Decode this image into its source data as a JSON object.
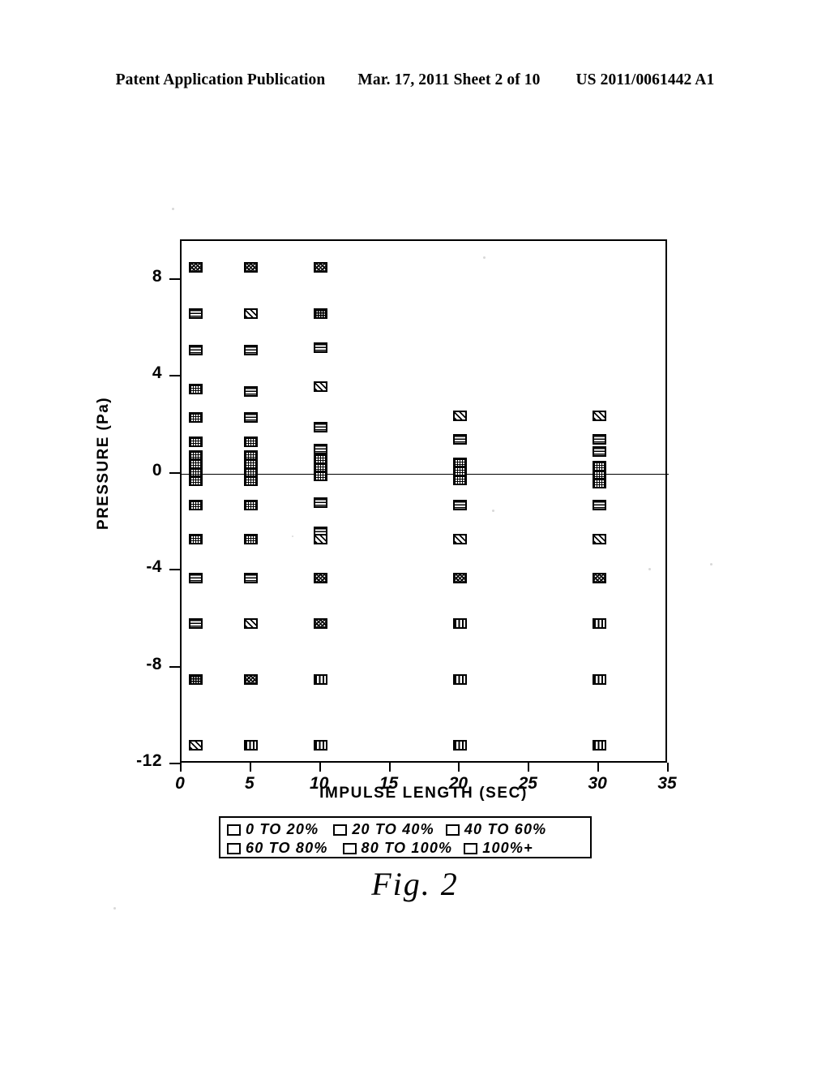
{
  "header": {
    "publication": "Patent Application Publication",
    "date_sheet": "Mar. 17, 2011  Sheet 2 of 10",
    "number": "US 2011/0061442 A1"
  },
  "figure": {
    "caption": "Fig.  2"
  },
  "chart_data": {
    "type": "scatter",
    "title": "",
    "xlabel": "IMPULSE LENGTH (SEC)",
    "ylabel": "PRESSURE (Pa)",
    "xlim": [
      0,
      35
    ],
    "ylim": [
      -12,
      9.6
    ],
    "xticks": [
      0,
      5,
      10,
      15,
      20,
      25,
      30,
      35
    ],
    "xtick_labels": [
      "0",
      "5",
      "10",
      "15",
      "20",
      "25",
      "30",
      "35"
    ],
    "yticks": [
      8,
      4,
      0,
      -4,
      -8,
      -12
    ],
    "ytick_labels": [
      "8",
      "4",
      "0",
      "-4",
      "-8",
      "-12"
    ],
    "grid": false,
    "zero_line": true,
    "legend_position": "below-axes",
    "categories": [
      "0 TO 20%",
      "20 TO 40%",
      "40 TO 60%",
      "60 TO 80%",
      "80 TO 100%",
      "100%+"
    ],
    "series": [
      {
        "name": "0 TO 20%",
        "pattern": "fine-cross-grid",
        "points": [
          [
            1,
            3.5
          ],
          [
            1,
            2.3
          ],
          [
            1,
            1.3
          ],
          [
            1,
            0.75
          ],
          [
            1,
            0.4
          ],
          [
            1,
            0.05
          ],
          [
            1,
            -0.3
          ],
          [
            1,
            -1.3
          ],
          [
            1,
            -2.7
          ],
          [
            5,
            1.3
          ],
          [
            5,
            0.75
          ],
          [
            5,
            0.4
          ],
          [
            5,
            0.05
          ],
          [
            5,
            -0.3
          ],
          [
            5,
            -1.3
          ],
          [
            5,
            -2.7
          ],
          [
            10,
            0.6
          ],
          [
            10,
            0.25
          ],
          [
            10,
            -0.1
          ],
          [
            20,
            0.45
          ],
          [
            20,
            0.1
          ],
          [
            20,
            -0.25
          ],
          [
            30,
            0.3
          ],
          [
            30,
            -0.05
          ],
          [
            30,
            -0.4
          ]
        ]
      },
      {
        "name": "20 TO 40%",
        "pattern": "horizontal-lines",
        "points": [
          [
            1,
            8.5
          ],
          [
            1,
            6.6
          ],
          [
            1,
            5.1
          ],
          [
            1,
            -4.3
          ],
          [
            1,
            -6.2
          ],
          [
            5,
            5.1
          ],
          [
            5,
            3.4
          ],
          [
            5,
            2.3
          ],
          [
            5,
            -4.3
          ],
          [
            10,
            5.2
          ],
          [
            10,
            1.9
          ],
          [
            10,
            1.0
          ],
          [
            10,
            -1.2
          ],
          [
            10,
            -2.4
          ],
          [
            20,
            1.4
          ],
          [
            20,
            -1.3
          ],
          [
            30,
            1.4
          ],
          [
            30,
            0.9
          ],
          [
            30,
            -1.3
          ]
        ]
      },
      {
        "name": "40 TO 60%",
        "pattern": "diagonal-lines",
        "points": [
          [
            1,
            -11.2
          ],
          [
            5,
            6.6
          ],
          [
            5,
            -6.2
          ],
          [
            10,
            3.6
          ],
          [
            10,
            -2.7
          ],
          [
            20,
            2.4
          ],
          [
            20,
            -2.7
          ],
          [
            30,
            2.4
          ],
          [
            30,
            -2.7
          ]
        ]
      },
      {
        "name": "60 TO 80%",
        "pattern": "heavy-cross-grid",
        "points": [
          [
            1,
            -8.5
          ],
          [
            5,
            -8.5
          ],
          [
            10,
            6.6
          ]
        ]
      },
      {
        "name": "80 TO 100%",
        "pattern": "speckle",
        "points": [
          [
            1,
            8.5
          ],
          [
            5,
            8.5
          ],
          [
            5,
            -8.5
          ],
          [
            10,
            8.5
          ],
          [
            10,
            -4.3
          ],
          [
            10,
            -6.2
          ],
          [
            20,
            -4.3
          ],
          [
            30,
            -4.3
          ]
        ]
      },
      {
        "name": "100%+",
        "pattern": "vertical-lines",
        "points": [
          [
            5,
            -11.2
          ],
          [
            10,
            -8.5
          ],
          [
            10,
            -11.2
          ],
          [
            20,
            -6.2
          ],
          [
            20,
            -8.5
          ],
          [
            20,
            -11.2
          ],
          [
            30,
            -6.2
          ],
          [
            30,
            -8.5
          ],
          [
            30,
            -11.2
          ]
        ]
      }
    ]
  },
  "legend": {
    "items": [
      {
        "label": "0 TO 20%",
        "pattern": "fine-cross-grid"
      },
      {
        "label": "20 TO 40%",
        "pattern": "horizontal-lines"
      },
      {
        "label": "40 TO 60%",
        "pattern": "diagonal-lines"
      },
      {
        "label": "60 TO 80%",
        "pattern": "heavy-cross-grid"
      },
      {
        "label": "80 TO 100%",
        "pattern": "speckle"
      },
      {
        "label": "100%+",
        "pattern": "vertical-lines"
      }
    ]
  }
}
